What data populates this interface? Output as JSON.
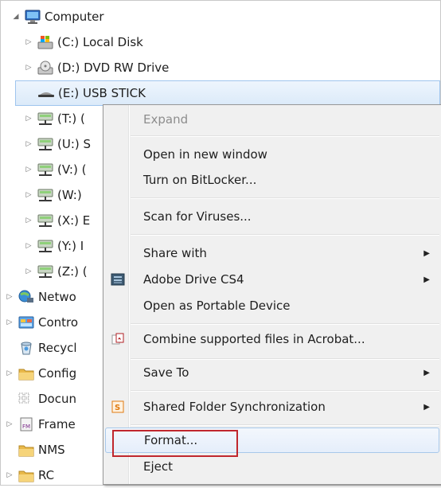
{
  "tree": {
    "computer": "Computer",
    "c_drive": "(C:) Local Disk",
    "d_drive": "(D:) DVD RW Drive",
    "e_drive": "(E:) USB STICK",
    "t_drive": "(T:) (",
    "u_drive": "(U:) S",
    "v_drive": "(V:) (",
    "w_drive": "(W:)",
    "x_drive": "(X:) E",
    "y_drive": "(Y:) I",
    "z_drive": "(Z:) (",
    "network": "Netwo",
    "control": "Contro",
    "recycle": "Recycl",
    "config": "Config",
    "documents": "Docun",
    "frame": "Frame",
    "nms": "NMS",
    "rc": "RC"
  },
  "context_menu": {
    "expand": "Expand",
    "open_new_window": "Open in new window",
    "bitlocker": "Turn on BitLocker...",
    "scan": "Scan for Viruses...",
    "share_with": "Share with",
    "adobe_drive": "Adobe Drive CS4",
    "portable": "Open as Portable Device",
    "combine": "Combine supported files in Acrobat...",
    "save_to": "Save To",
    "shared_sync": "Shared Folder Synchronization",
    "format": "Format...",
    "eject": "Eject",
    "submenu_glyph": "▶"
  },
  "colors": {
    "highlight": "#c0272d",
    "selection": "#dbeaf9"
  }
}
